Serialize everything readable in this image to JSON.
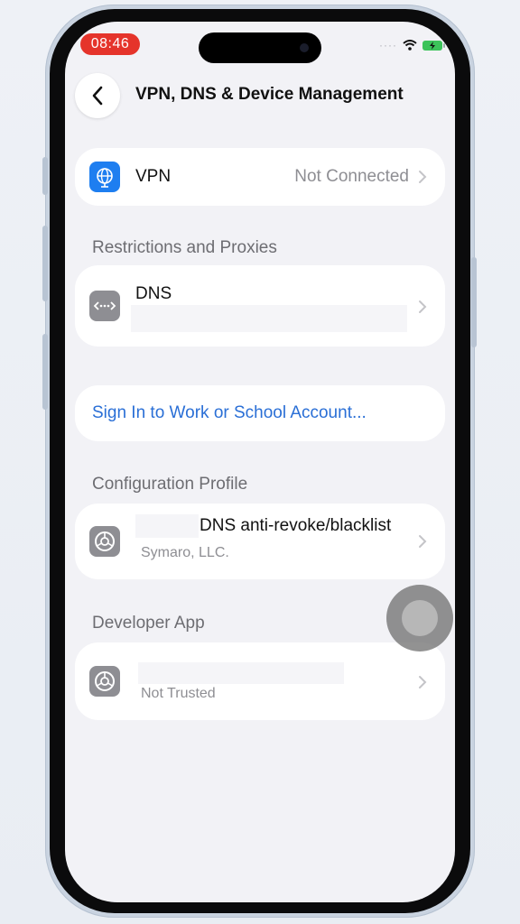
{
  "status_bar": {
    "time": "08:46"
  },
  "nav": {
    "back_icon": "chevron-left-icon",
    "title": "VPN, DNS & Device Management"
  },
  "vpn": {
    "label": "VPN",
    "value": "Not Connected",
    "icon": "globe-icon",
    "icon_color": "#1e7ef0"
  },
  "restrictions": {
    "header": "Restrictions and Proxies",
    "dns_label": "DNS",
    "icon": "dns-arrows-icon",
    "icon_color": "#8e8e93"
  },
  "work_account": {
    "label": "Sign In to Work or School Account...",
    "color": "#2a6fd6"
  },
  "config_profile": {
    "header": "Configuration Profile",
    "name": "DNS anti-revoke/blacklist",
    "publisher": "Symaro, LLC.",
    "icon": "gear-icon"
  },
  "developer_app": {
    "header": "Developer App",
    "status": "Not Trusted",
    "icon": "gear-icon"
  }
}
